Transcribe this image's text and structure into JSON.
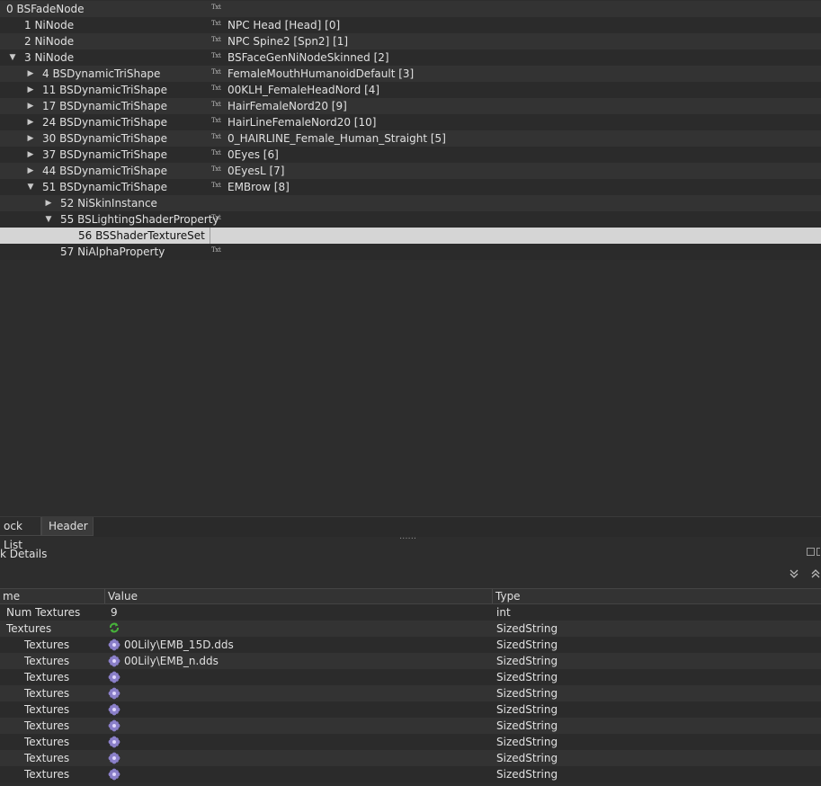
{
  "tree": {
    "rows": [
      {
        "label": "0 BSFadeNode",
        "value": ""
      },
      {
        "label": "1 NiNode",
        "value": "NPC Head [Head] [0]"
      },
      {
        "label": "2 NiNode",
        "value": "NPC Spine2 [Spn2] [1]"
      },
      {
        "label": "3 NiNode",
        "value": "BSFaceGenNiNodeSkinned [2]"
      },
      {
        "label": "4 BSDynamicTriShape",
        "value": "FemaleMouthHumanoidDefault [3]"
      },
      {
        "label": "11 BSDynamicTriShape",
        "value": "00KLH_FemaleHeadNord [4]"
      },
      {
        "label": "17 BSDynamicTriShape",
        "value": "HairFemaleNord20 [9]"
      },
      {
        "label": "24 BSDynamicTriShape",
        "value": "HairLineFemaleNord20 [10]"
      },
      {
        "label": "30 BSDynamicTriShape",
        "value": "0_HAIRLINE_Female_Human_Straight [5]"
      },
      {
        "label": "37 BSDynamicTriShape",
        "value": "0Eyes [6]"
      },
      {
        "label": "44 BSDynamicTriShape",
        "value": "0EyesL [7]"
      },
      {
        "label": "51 BSDynamicTriShape",
        "value": "EMBrow [8]"
      },
      {
        "label": "52 NiSkinInstance",
        "value": ""
      },
      {
        "label": "55 BSLightingShaderProperty",
        "value": ""
      },
      {
        "label": "56 BSShaderTextureSet",
        "value": ""
      },
      {
        "label": "57 NiAlphaProperty",
        "value": ""
      }
    ],
    "txt_icon": "Txt"
  },
  "tabs": [
    "ock List",
    "Header"
  ],
  "dock_title": "k Details",
  "grid": {
    "headers": [
      "me",
      "Value",
      "Type"
    ],
    "rows": [
      {
        "name": "Num Textures",
        "value": "9",
        "type": "int"
      },
      {
        "name": "Textures",
        "value": "",
        "type": "SizedString"
      },
      {
        "name": "Textures",
        "value": "00Lily\\EMB_15D.dds",
        "type": "SizedString"
      },
      {
        "name": "Textures",
        "value": "00Lily\\EMB_n.dds",
        "type": "SizedString"
      },
      {
        "name": "Textures",
        "value": "",
        "type": "SizedString"
      },
      {
        "name": "Textures",
        "value": "",
        "type": "SizedString"
      },
      {
        "name": "Textures",
        "value": "",
        "type": "SizedString"
      },
      {
        "name": "Textures",
        "value": "",
        "type": "SizedString"
      },
      {
        "name": "Textures",
        "value": "",
        "type": "SizedString"
      },
      {
        "name": "Textures",
        "value": "",
        "type": "SizedString"
      },
      {
        "name": "Textures",
        "value": "",
        "type": "SizedString"
      }
    ]
  },
  "colors": {
    "selection": "#d5d5d5",
    "background": "#2d2d2d"
  }
}
